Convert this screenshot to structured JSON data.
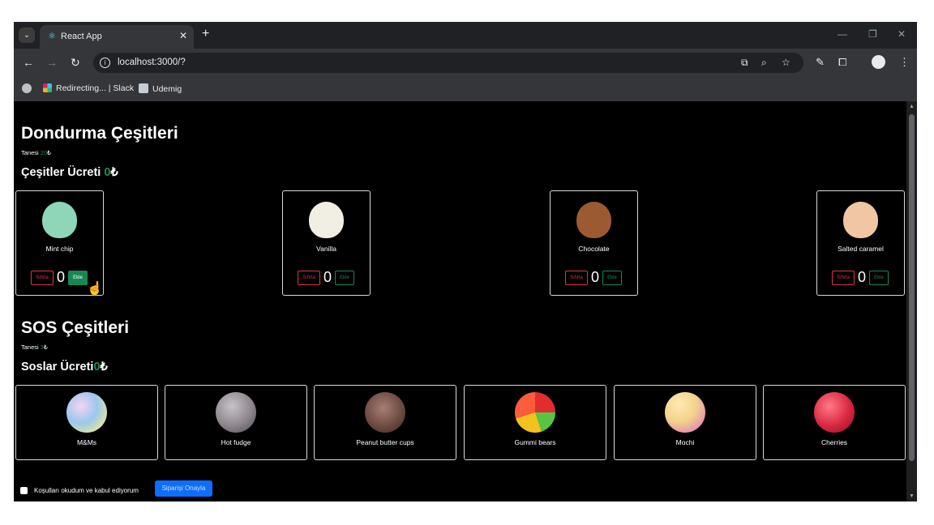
{
  "browser": {
    "tab_title": "React App",
    "url": "localhost:3000/?",
    "bookmarks": [
      "Redirecting... | Slack",
      "Udemig"
    ]
  },
  "ice_section": {
    "title": "Dondurma Çeşitleri",
    "unit_label": "Tanesi",
    "unit_price": "20",
    "currency": "₺",
    "total_label": "Çeşitler Ücreti",
    "total_value": "0"
  },
  "ice_creams": [
    {
      "name": "Mint chip",
      "count": "0",
      "reset_label": "Sıfırla",
      "add_label": "Ekle",
      "color": "#8fd6b8"
    },
    {
      "name": "Vanilla",
      "count": "0",
      "reset_label": "Sıfırla",
      "add_label": "Ekle",
      "color": "#f1eee3"
    },
    {
      "name": "Chocolate",
      "count": "0",
      "reset_label": "Sıfırla",
      "add_label": "Ekle",
      "color": "#9b5a32"
    },
    {
      "name": "Salted caramel",
      "count": "0",
      "reset_label": "Sıfırla",
      "add_label": "Ekle",
      "color": "#f0c7a2"
    }
  ],
  "sauce_section": {
    "title": "SOS Çeşitleri",
    "unit_label": "Tanesi",
    "unit_price": "3",
    "currency": "₺",
    "total_label": "Soslar Ücreti",
    "total_value": "0"
  },
  "sauces": [
    {
      "name": "M&Ms",
      "color": "#b5d7e8"
    },
    {
      "name": "Hot fudge",
      "color": "#8d878d"
    },
    {
      "name": "Peanut butter cups",
      "color": "#6e4b42"
    },
    {
      "name": "Gummi bears",
      "color": "#df4b3d"
    },
    {
      "name": "Mochi",
      "color": "#f2d38b"
    },
    {
      "name": "Cherries",
      "color": "#d9263f"
    }
  ],
  "terms_label": "Koşulları okudum ve kabul ediyorum",
  "submit_label": "Siparişi Onayla"
}
